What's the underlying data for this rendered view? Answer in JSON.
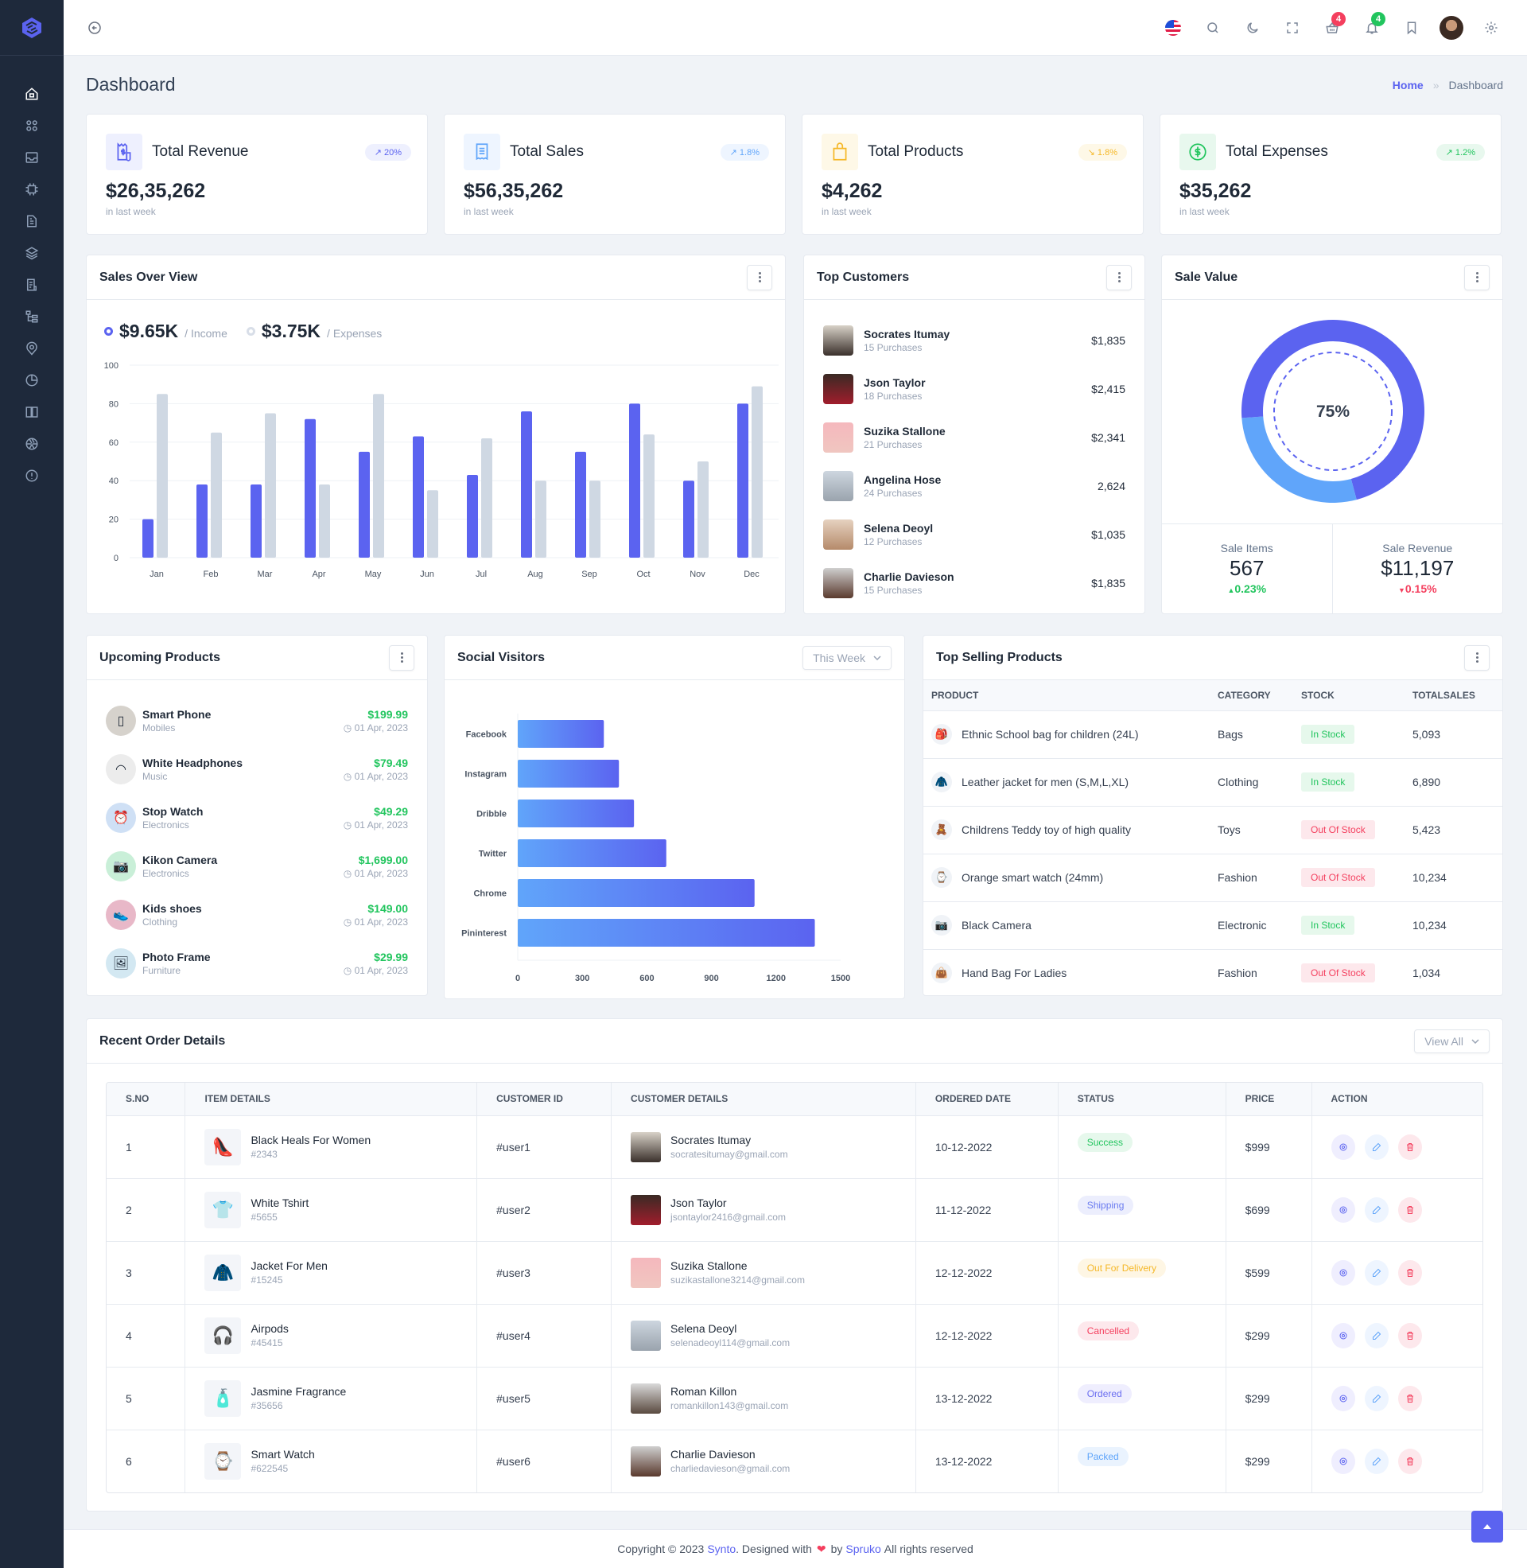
{
  "header": {
    "badges": {
      "cart": "4",
      "notifications": "4"
    },
    "icons": [
      "flag-us-icon",
      "search-icon",
      "moon-icon",
      "fullscreen-icon",
      "cart-icon",
      "bell-icon",
      "bookmark-icon",
      "user-avatar",
      "gear-icon"
    ]
  },
  "sidebar": {
    "items": [
      {
        "icon": "home-icon",
        "active": true
      },
      {
        "icon": "apps-icon"
      },
      {
        "icon": "inbox-icon"
      },
      {
        "icon": "chip-icon"
      },
      {
        "icon": "file-icon"
      },
      {
        "icon": "layers-icon"
      },
      {
        "icon": "receipt-icon"
      },
      {
        "icon": "hierarchy-icon"
      },
      {
        "icon": "map-pin-user-icon"
      },
      {
        "icon": "pie-chart-icon"
      },
      {
        "icon": "book-icon"
      },
      {
        "icon": "aperture-icon"
      },
      {
        "icon": "alert-circle-icon"
      }
    ]
  },
  "page": {
    "title": "Dashboard",
    "breadcrumb": {
      "home": "Home",
      "sep": "»",
      "current": "Dashboard"
    }
  },
  "stats": [
    {
      "label": "Total Revenue",
      "value": "$26,35,262",
      "sub": "in last week",
      "change": "20%",
      "trend": "up",
      "icon": "receipt-dollar-icon",
      "color": "#5b63f0",
      "bg": "#eef0fe"
    },
    {
      "label": "Total Sales",
      "value": "$56,35,262",
      "sub": "in last week",
      "change": "1.8%",
      "trend": "up",
      "icon": "receipt-icon",
      "color": "#60a5fa",
      "bg": "#eef5ff"
    },
    {
      "label": "Total Products",
      "value": "$4,262",
      "sub": "in last week",
      "change": "1.8%",
      "trend": "down",
      "icon": "shopping-bag-icon",
      "color": "#f5b829",
      "bg": "#fef8e7"
    },
    {
      "label": "Total Expenses",
      "value": "$35,262",
      "sub": "in last week",
      "change": "1.2%",
      "trend": "up",
      "icon": "dollar-circle-icon",
      "color": "#22c55e",
      "bg": "#e8f8ee"
    }
  ],
  "sales_overview": {
    "title": "Sales Over View",
    "income": {
      "amount": "$9.65K",
      "label": "/ Income"
    },
    "expenses": {
      "amount": "$3.75K",
      "label": "/ Expenses"
    }
  },
  "top_customers": {
    "title": "Top Customers",
    "items": [
      {
        "name": "Socrates Itumay",
        "purchases": "15 Purchases",
        "amount": "$1,835"
      },
      {
        "name": "Json Taylor",
        "purchases": "18 Purchases",
        "amount": "$2,415"
      },
      {
        "name": "Suzika Stallone",
        "purchases": "21 Purchases",
        "amount": "$2,341"
      },
      {
        "name": "Angelina Hose",
        "purchases": "24 Purchases",
        "amount": "2,624"
      },
      {
        "name": "Selena Deoyl",
        "purchases": "12 Purchases",
        "amount": "$1,035"
      },
      {
        "name": "Charlie Davieson",
        "purchases": "15 Purchases",
        "amount": "$1,835"
      }
    ]
  },
  "sale_value": {
    "title": "Sale Value",
    "center_label": "75%",
    "items": {
      "label": "Sale Items",
      "value": "567",
      "change": "0.23%",
      "trend": "up"
    },
    "revenue": {
      "label": "Sale Revenue",
      "value": "$11,197",
      "change": "0.15%",
      "trend": "down"
    }
  },
  "upcoming_products": {
    "title": "Upcoming Products",
    "items": [
      {
        "name": "Smart Phone",
        "category": "Mobiles",
        "price": "$199.99",
        "date": "01 Apr, 2023"
      },
      {
        "name": "White Headphones",
        "category": "Music",
        "price": "$79.49",
        "date": "01 Apr, 2023"
      },
      {
        "name": "Stop Watch",
        "category": "Electronics",
        "price": "$49.29",
        "date": "01 Apr, 2023"
      },
      {
        "name": "Kikon Camera",
        "category": "Electronics",
        "price": "$1,699.00",
        "date": "01 Apr, 2023"
      },
      {
        "name": "Kids shoes",
        "category": "Clothing",
        "price": "$149.00",
        "date": "01 Apr, 2023"
      },
      {
        "name": "Photo Frame",
        "category": "Furniture",
        "price": "$29.99",
        "date": "01 Apr, 2023"
      }
    ]
  },
  "social_visitors": {
    "title": "Social Visitors",
    "filter": "This Week"
  },
  "top_selling": {
    "title": "Top Selling Products",
    "columns": [
      "PRODUCT",
      "CATEGORY",
      "STOCK",
      "TOTALSALES"
    ],
    "rows": [
      {
        "product": "Ethnic School bag for children (24L)",
        "category": "Bags",
        "stock": "In Stock",
        "in_stock": true,
        "sales": "5,093"
      },
      {
        "product": "Leather jacket for men (S,M,L,XL)",
        "category": "Clothing",
        "stock": "In Stock",
        "in_stock": true,
        "sales": "6,890"
      },
      {
        "product": "Childrens Teddy toy of high quality",
        "category": "Toys",
        "stock": "Out Of Stock",
        "in_stock": false,
        "sales": "5,423"
      },
      {
        "product": "Orange smart watch (24mm)",
        "category": "Fashion",
        "stock": "Out Of Stock",
        "in_stock": false,
        "sales": "10,234"
      },
      {
        "product": "Black Camera",
        "category": "Electronic",
        "stock": "In Stock",
        "in_stock": true,
        "sales": "10,234"
      },
      {
        "product": "Hand Bag For Ladies",
        "category": "Fashion",
        "stock": "Out Of Stock",
        "in_stock": false,
        "sales": "1,034"
      }
    ]
  },
  "recent_orders": {
    "title": "Recent Order Details",
    "view_all": "View All",
    "columns": [
      "S.NO",
      "ITEM DETAILS",
      "CUSTOMER ID",
      "CUSTOMER DETAILS",
      "ORDERED DATE",
      "STATUS",
      "PRICE",
      "ACTION"
    ],
    "rows": [
      {
        "sno": "1",
        "item": "Black Heals For Women",
        "item_id": "#2343",
        "customer_id": "#user1",
        "customer": "Socrates Itumay",
        "email": "socratesitumay@gmail.com",
        "date": "10-12-2022",
        "status": "Success",
        "price": "$999"
      },
      {
        "sno": "2",
        "item": "White Tshirt",
        "item_id": "#5655",
        "customer_id": "#user2",
        "customer": "Json Taylor",
        "email": "jsontaylor2416@gmail.com",
        "date": "11-12-2022",
        "status": "Shipping",
        "price": "$699"
      },
      {
        "sno": "3",
        "item": "Jacket For Men",
        "item_id": "#15245",
        "customer_id": "#user3",
        "customer": "Suzika Stallone",
        "email": "suzikastallone3214@gmail.com",
        "date": "12-12-2022",
        "status": "Out For Delivery",
        "price": "$599"
      },
      {
        "sno": "4",
        "item": "Airpods",
        "item_id": "#45415",
        "customer_id": "#user4",
        "customer": "Selena Deoyl",
        "email": "selenadeoyl114@gmail.com",
        "date": "12-12-2022",
        "status": "Cancelled",
        "price": "$299"
      },
      {
        "sno": "5",
        "item": "Jasmine Fragrance",
        "item_id": "#35656",
        "customer_id": "#user5",
        "customer": "Roman Killon",
        "email": "romankillon143@gmail.com",
        "date": "13-12-2022",
        "status": "Ordered",
        "price": "$299"
      },
      {
        "sno": "6",
        "item": "Smart Watch",
        "item_id": "#622545",
        "customer_id": "#user6",
        "customer": "Charlie Davieson",
        "email": "charliedavieson@gmail.com",
        "date": "13-12-2022",
        "status": "Packed",
        "price": "$299"
      }
    ],
    "status_colors": {
      "Success": {
        "fg": "#22c55e",
        "bg": "#e6f8ec"
      },
      "Shipping": {
        "fg": "#6b7cf0",
        "bg": "#eceefd"
      },
      "Out For Delivery": {
        "fg": "#f5b829",
        "bg": "#fef6e4"
      },
      "Cancelled": {
        "fg": "#f43f5e",
        "bg": "#fde8ec"
      },
      "Ordered": {
        "fg": "#6b6ef0",
        "bg": "#efeefe"
      },
      "Packed": {
        "fg": "#60a5fa",
        "bg": "#eaf3fe"
      }
    }
  },
  "footer": {
    "prefix": "Copyright © 2023",
    "brand": "Synto",
    "middle": ". Designed with",
    "by": "by",
    "company": "Spruko",
    "suffix": "All rights reserved"
  },
  "colors": {
    "primary": "#5b63f0",
    "secondary_bar": "#cfd8e3",
    "light_blue": "#60a5fa",
    "success": "#22c55e",
    "danger": "#f43f5e",
    "sidebar": "#1e293b"
  },
  "chart_data": [
    {
      "type": "bar",
      "title": "Sales Over View",
      "categories": [
        "Jan",
        "Feb",
        "Mar",
        "Apr",
        "May",
        "Jun",
        "Jul",
        "Aug",
        "Sep",
        "Oct",
        "Nov",
        "Dec"
      ],
      "series": [
        {
          "name": "Income",
          "color": "#5b63f0",
          "values": [
            20,
            38,
            38,
            72,
            55,
            63,
            43,
            76,
            55,
            80,
            40,
            80
          ]
        },
        {
          "name": "Expenses",
          "color": "#cfd8e3",
          "values": [
            85,
            65,
            75,
            38,
            85,
            35,
            62,
            40,
            40,
            64,
            50,
            89
          ]
        }
      ],
      "yticks": [
        0,
        20,
        40,
        60,
        80,
        100
      ],
      "ylim": [
        0,
        100
      ],
      "grid": true
    },
    {
      "type": "pie",
      "title": "Sale Value",
      "labels": [
        "Sale Items",
        "Sale Revenue"
      ],
      "values": [
        72,
        28
      ],
      "colors": [
        "#5b63f0",
        "#60a5fa"
      ],
      "center_label": "75%"
    },
    {
      "type": "bar",
      "orientation": "horizontal",
      "title": "Social Visitors",
      "categories": [
        "Facebook",
        "Instagram",
        "Dribble",
        "Twitter",
        "Chrome",
        "Pininterest"
      ],
      "values": [
        400,
        470,
        540,
        690,
        1100,
        1380
      ],
      "xticks": [
        0,
        300,
        600,
        900,
        1200,
        1500
      ],
      "xlim": [
        0,
        1500
      ]
    }
  ]
}
